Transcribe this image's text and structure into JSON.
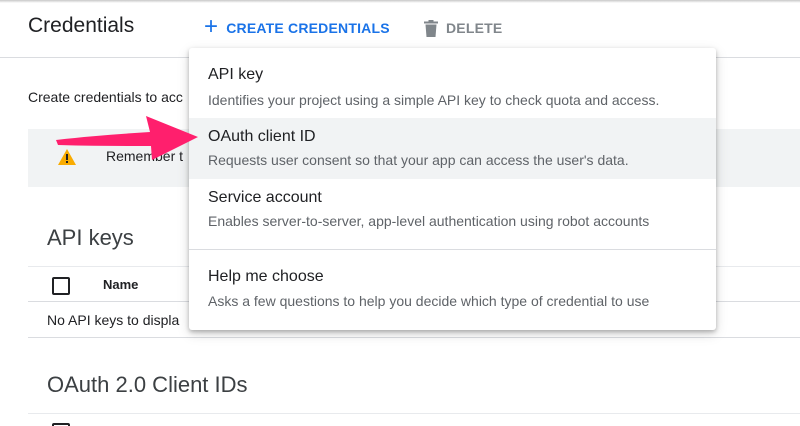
{
  "header": {
    "title": "Credentials",
    "create_label": "CREATE CREDENTIALS",
    "delete_label": "DELETE"
  },
  "intro": {
    "text": "Create credentials to acc"
  },
  "warning": {
    "text": "Remember t"
  },
  "api_keys": {
    "title": "API keys",
    "column_name": "Name",
    "empty_text": "No API keys to displa"
  },
  "oauth": {
    "title": "OAuth 2.0 Client IDs"
  },
  "menu": {
    "items": [
      {
        "title": "API key",
        "description": "Identifies your project using a simple API key to check quota and access."
      },
      {
        "title": "OAuth client ID",
        "description": "Requests user consent so that your app can access the user's data."
      },
      {
        "title": "Service account",
        "description": "Enables server-to-server, app-level authentication using robot accounts"
      },
      {
        "title": "Help me choose",
        "description": "Asks a few questions to help you decide which type of credential to use"
      }
    ]
  },
  "colors": {
    "accent": "#1a73e8",
    "arrow": "#ff1f6d",
    "warning": "#f9ab00"
  }
}
